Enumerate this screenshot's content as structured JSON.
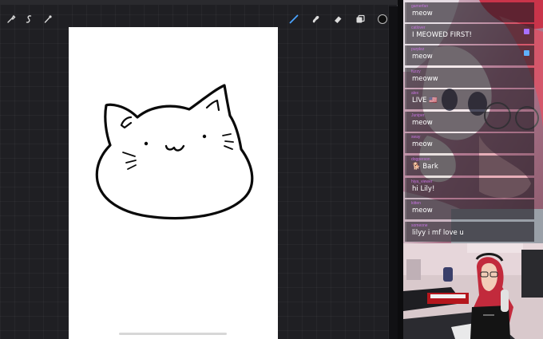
{
  "toolbar": {
    "left_tools": [
      {
        "icon": "wrench-icon"
      },
      {
        "icon": "adjustments-icon"
      },
      {
        "icon": "selection-icon"
      }
    ],
    "right_tools": [
      {
        "icon": "brush-icon",
        "active": true
      },
      {
        "icon": "smudge-icon"
      },
      {
        "icon": "eraser-icon"
      },
      {
        "icon": "layers-icon"
      },
      {
        "icon": "color-swatch-icon"
      }
    ],
    "accent_color": "#4aa3ff",
    "selected_color": "#0f0f0f"
  },
  "chat": {
    "messages": [
      {
        "user": "gamerfan",
        "text": "meow"
      },
      {
        "user": "catlover",
        "text": "I MEOWED FIRST!"
      },
      {
        "user": "purplez",
        "text": "meow"
      },
      {
        "user": "fuzzy",
        "text": "meoww"
      },
      {
        "user": "alex",
        "text": "LIVE 🇺🇸"
      },
      {
        "user": "Juniper",
        "text": "meow"
      },
      {
        "user": "sway",
        "text": "meow"
      },
      {
        "user": "dogperson",
        "text": "🐕 Bark"
      },
      {
        "user": "hiya_viewer",
        "text": "hi Lily!"
      },
      {
        "user": "kitten",
        "text": "meow"
      },
      {
        "user": "someone",
        "text": "lilyy i mf love u"
      }
    ]
  }
}
